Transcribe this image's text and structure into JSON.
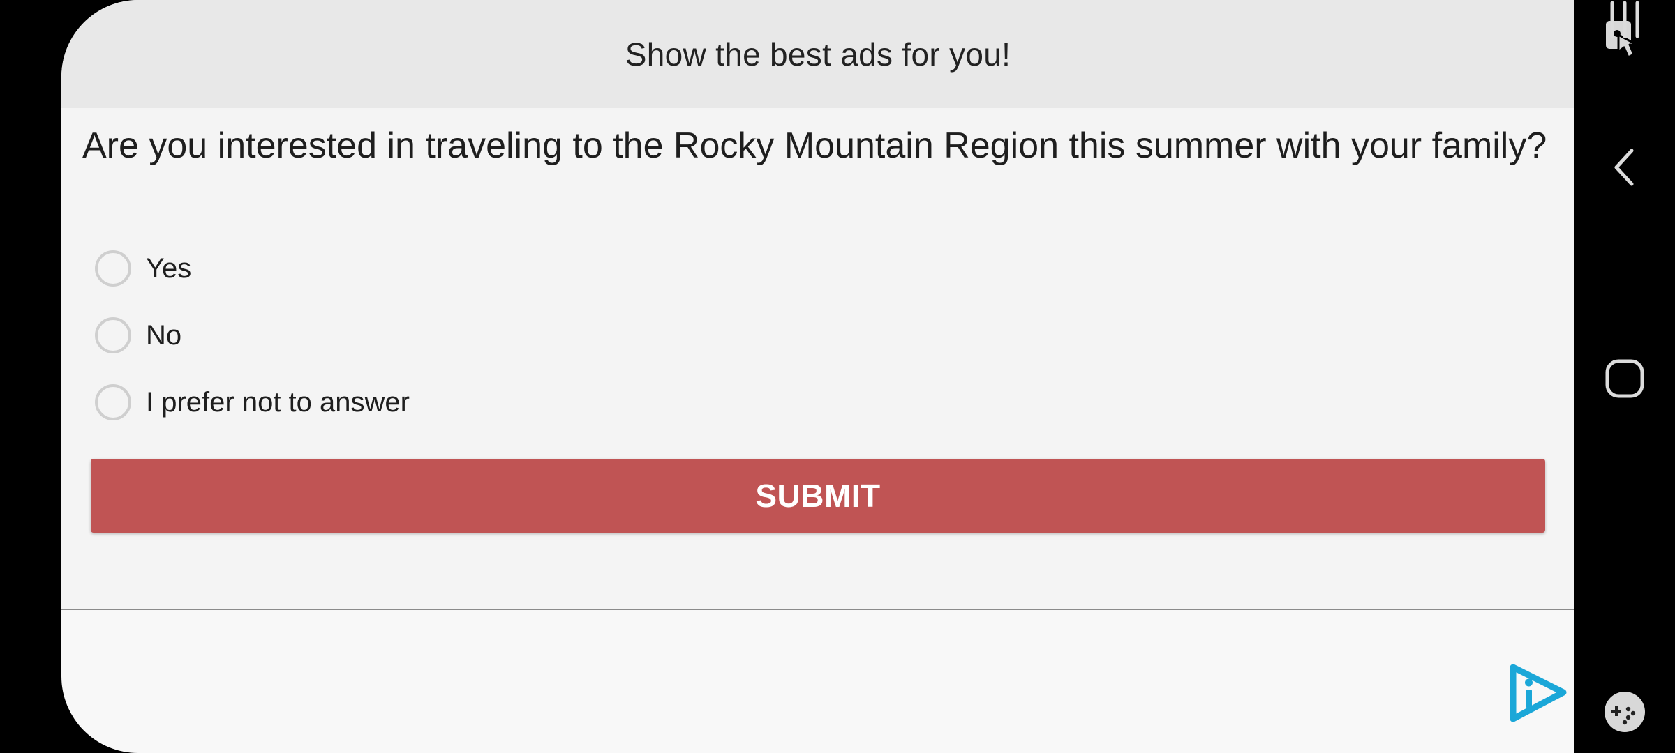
{
  "survey": {
    "header_title": "Show the best ads for you!",
    "question": "Are you interested in traveling to the Rocky Mountain Region this summer with your family?",
    "options": [
      {
        "label": "Yes"
      },
      {
        "label": "No"
      },
      {
        "label": "I prefer not to answer"
      }
    ],
    "submit_label": "SUBMIT"
  },
  "brand": {
    "logo_icon": "play-i-logo-icon",
    "color": "#1ba7d8"
  },
  "colors": {
    "header_bg": "#e8e8e8",
    "body_bg": "#f4f4f4",
    "submit_bg": "#c05454"
  },
  "nav_rail": {
    "icons": [
      "screen-touch-icon",
      "back-icon",
      "home-icon",
      "recents-icon",
      "game-tools-icon"
    ]
  }
}
